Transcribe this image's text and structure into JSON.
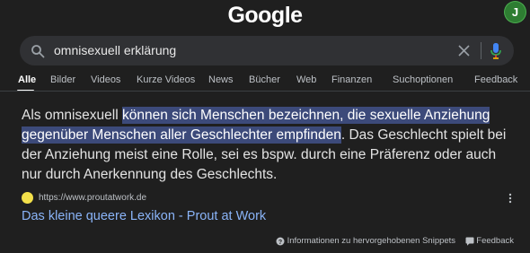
{
  "header": {
    "logo": "Google",
    "avatar_initial": "J"
  },
  "search": {
    "query": "omnisexuell erklärung"
  },
  "tabs": [
    {
      "label": "Alle",
      "active": true
    },
    {
      "label": "Bilder"
    },
    {
      "label": "Videos"
    },
    {
      "label": "Kurze Videos"
    },
    {
      "label": "News"
    },
    {
      "label": "Bücher"
    },
    {
      "label": "Web"
    },
    {
      "label": "Finanzen"
    },
    {
      "label": "Suchoptionen"
    },
    {
      "label": "Feedback"
    }
  ],
  "snippet": {
    "before": "Als omnisexuell ",
    "highlight1": "können sich Menschen bezeichnen, die sexuelle Anziehung",
    "highlight2": "gegenüber Menschen aller Geschlechter empfinden",
    "after": ". Das Geschlecht spielt bei der Anziehung meist eine Rolle, sei es bspw. durch eine Präferenz oder auch nur durch Anerkennung des Geschlechts."
  },
  "source": {
    "url": "https://www.proutatwork.de",
    "title": "Das kleine queere Lexikon - Prout at Work"
  },
  "footer": {
    "info_label": "Informationen zu hervorgehobenen Snippets",
    "feedback_label": "Feedback"
  },
  "colors": {
    "background": "#1f1f1f",
    "highlight": "#3c4a7a",
    "link": "#8ab4f8",
    "avatar": "#2e7d32"
  }
}
